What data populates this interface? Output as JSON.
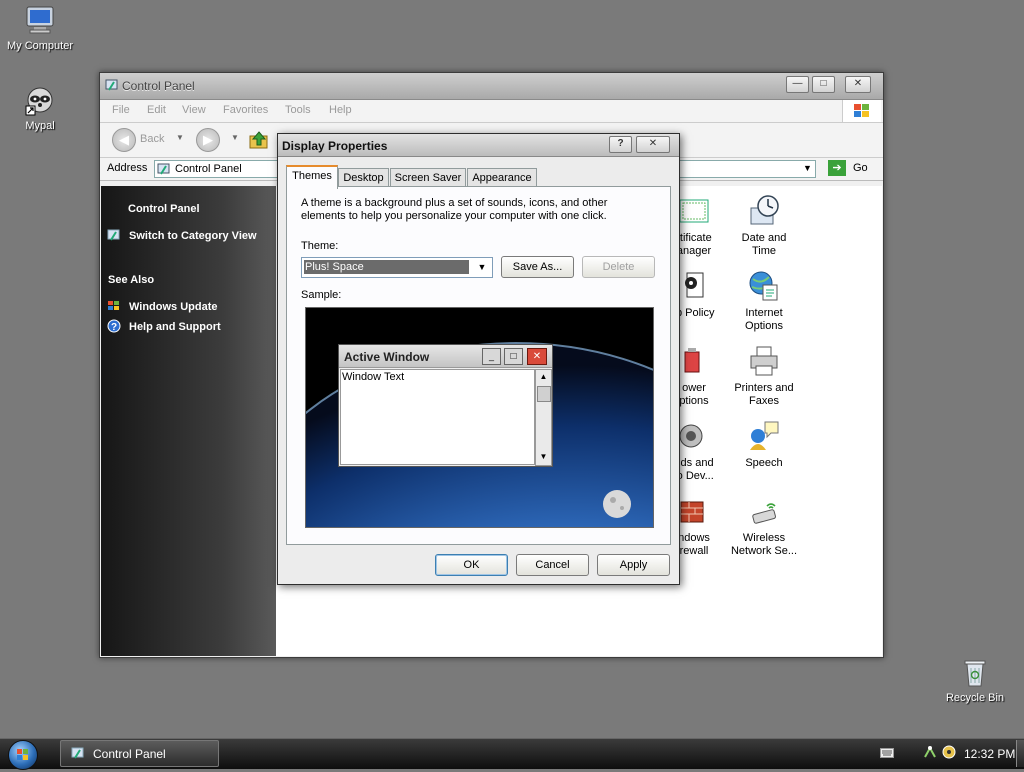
{
  "desktop": {
    "icons": [
      {
        "label": "My Computer",
        "icon": "monitor-icon"
      },
      {
        "label": "Mypal",
        "icon": "raccoon-icon"
      },
      {
        "label": "Recycle Bin",
        "icon": "recycle-bin-icon"
      }
    ]
  },
  "control_panel": {
    "title": "Control Panel",
    "menu": [
      "File",
      "Edit",
      "View",
      "Favorites",
      "Tools",
      "Help"
    ],
    "toolbar": {
      "back_label": "Back"
    },
    "address": {
      "label": "Address",
      "value": "Control Panel",
      "go_label": "Go"
    },
    "left_pane": {
      "header": "Control Panel",
      "switch_view": "Switch to Category View",
      "see_also_header": "See Also",
      "links": [
        "Windows Update",
        "Help and Support"
      ]
    },
    "items": [
      {
        "line1": "rtificate",
        "line2": "anager",
        "icon": "certificate-icon"
      },
      {
        "line1": "Date and",
        "line2": "Time",
        "icon": "clock-icon"
      },
      {
        "line1": "ip Policy",
        "line2": "",
        "icon": "policy-icon"
      },
      {
        "line1": "Internet",
        "line2": "Options",
        "icon": "internet-options-icon"
      },
      {
        "line1": "ower",
        "line2": "ptions",
        "icon": "power-icon"
      },
      {
        "line1": "Printers and",
        "line2": "Faxes",
        "icon": "printer-icon"
      },
      {
        "line1": "nds and",
        "line2": "io Dev...",
        "icon": "speaker-icon"
      },
      {
        "line1": "Speech",
        "line2": "",
        "icon": "speech-icon"
      },
      {
        "line1": "ndows",
        "line2": "rewall",
        "icon": "firewall-icon"
      },
      {
        "line1": "Wireless",
        "line2": "Network Se...",
        "icon": "wireless-icon"
      }
    ]
  },
  "display_properties": {
    "title": "Display Properties",
    "tabs": [
      "Themes",
      "Desktop",
      "Screen Saver",
      "Appearance"
    ],
    "description": "A theme is a background plus a set of sounds, icons, and other elements to help you personalize your computer with one click.",
    "theme_label": "Theme:",
    "theme_value": "Plus! Space",
    "save_as": "Save As...",
    "delete": "Delete",
    "sample_label": "Sample:",
    "sample_window": {
      "title": "Active Window",
      "text": "Window Text"
    },
    "buttons": {
      "ok": "OK",
      "cancel": "Cancel",
      "apply": "Apply"
    }
  },
  "taskbar": {
    "task": "Control Panel",
    "time": "12:32 PM"
  }
}
